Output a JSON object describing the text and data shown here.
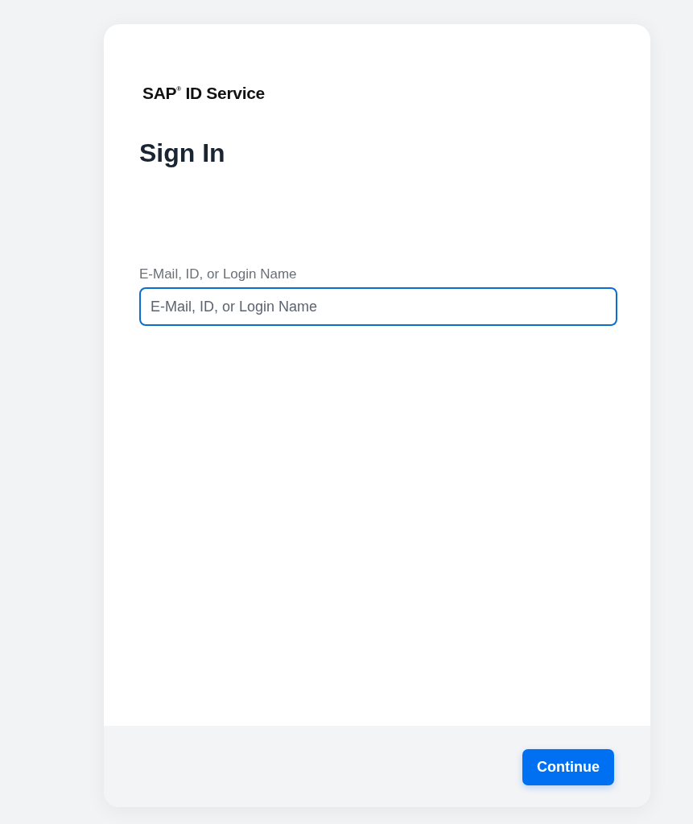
{
  "brand": "SAP$^{®}$ ID Service",
  "title": "Sign In",
  "field": {
    "label": "E-Mail, ID, or Login Name",
    "placeholder": "E-Mail, ID, or Login Name",
    "focused": true
  },
  "buttons": [
    "Continue"
  ]
}
